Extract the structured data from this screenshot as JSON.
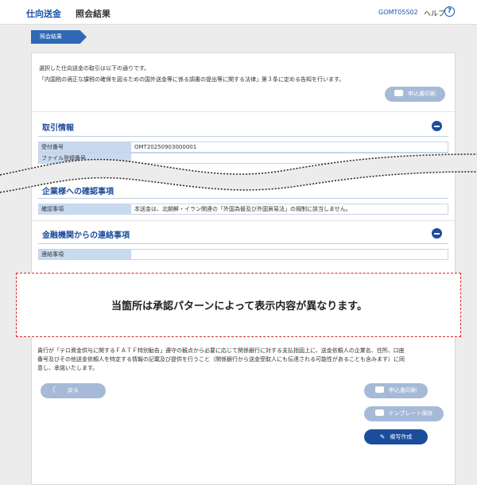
{
  "header": {
    "nav_primary": "仕向送金",
    "nav_secondary": "照会結果",
    "screen_code": "GOMT05S02",
    "help_label": "ヘルプ",
    "help_icon_glyph": "?"
  },
  "breadcrumb": "照会結果",
  "intro": {
    "line1": "選択した仕向送金の取引は以下の通りです。",
    "line2": "「内国税の適正な課税の確保を図るための国外送金等に係る調書の提出等に関する法律」第３条に定める告知を行います。"
  },
  "buttons": {
    "apply_print_top": "申込書印刷",
    "back": "戻る",
    "back_icon_glyph": "〈",
    "apply_print_bottom": "申込書印刷",
    "template_save": "テンプレート保存",
    "copy_create": "複写作成",
    "copy_create_icon_glyph": "✎"
  },
  "sections": {
    "transaction": {
      "title": "取引情報",
      "rows": [
        {
          "label": "受付番号",
          "value": "OMT20250903000001"
        },
        {
          "label": "ファイル登録番号",
          "value": ""
        }
      ]
    },
    "company_confirm": {
      "title": "企業様への確認事項",
      "rows": [
        {
          "label": "確認事項",
          "value": "本送金は、北朝鮮・イラン関連の「外国為替及び外国貿易法」の規制に該当しません。"
        }
      ]
    },
    "bank_contact": {
      "title": "金融機関からの連絡事項",
      "rows": [
        {
          "label": "連絡事項",
          "value": ""
        }
      ]
    }
  },
  "notice": "当箇所は承認パターンによって表示内容が異なります。",
  "fatf": {
    "line1": "貴行が「テロ資金供与に関するＦＡＴＦ特別勧告」遵守の観点から必要に応じて関係銀行に対する支払指図上に、送金依頼人の企業名、住所、口座",
    "line2": "番号及びその他送金依頼人を特定する情報の記載及び提供を行うこと（関係銀行から送金受取人にも伝達される可能性があることも含みます）に同",
    "line3": "意し、承諾いたします。"
  },
  "colors": {
    "brand": "#1c4c9c",
    "link": "#1a53a8",
    "label_bg": "#c8daf0",
    "disabled_button": "#a6bad8",
    "notice_border": "#d8281f"
  }
}
